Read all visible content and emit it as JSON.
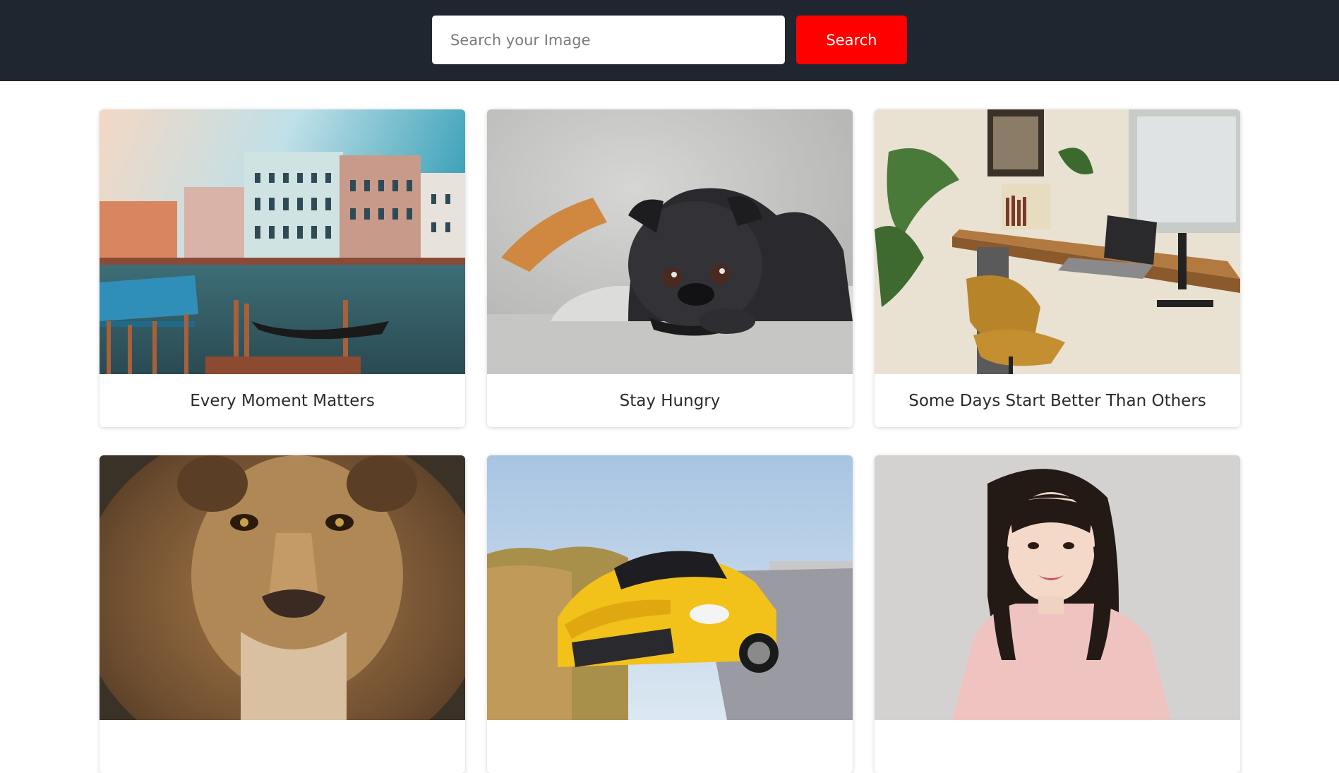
{
  "search": {
    "placeholder": "Search your Image",
    "value": "",
    "button_label": "Search"
  },
  "cards": [
    {
      "caption": "Every Moment Matters",
      "image": "venice-canal-photo"
    },
    {
      "caption": "Stay Hungry",
      "image": "black-pug-photo"
    },
    {
      "caption": "Some Days Start Better Than Others",
      "image": "home-office-desk-photo"
    },
    {
      "caption": "",
      "image": "lion-face-photo"
    },
    {
      "caption": "",
      "image": "yellow-sports-car-photo"
    },
    {
      "caption": "",
      "image": "woman-portrait-photo"
    }
  ],
  "colors": {
    "header_bg": "#202630",
    "search_button_bg": "#fe0000",
    "page_bg": "#ffffff"
  }
}
